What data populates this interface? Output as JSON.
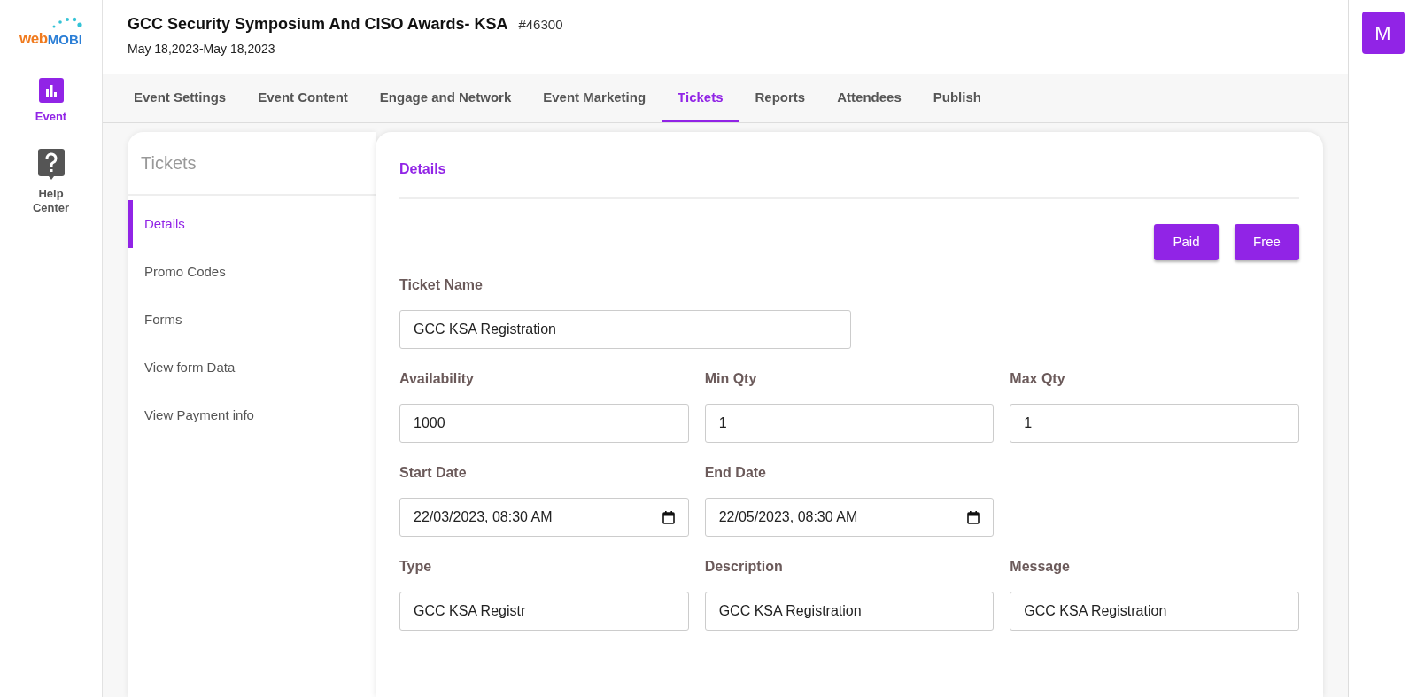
{
  "logo": {
    "first": "web",
    "second": "MOBI"
  },
  "sidebar": {
    "items": [
      {
        "label": "Event",
        "kind": "chart",
        "selected": true
      },
      {
        "label": "Help Center",
        "kind": "help",
        "selected": false
      }
    ]
  },
  "header": {
    "title": "GCC Security Symposium And CISO Awards- KSA",
    "event_id": "#46300",
    "dates": "May 18,2023-May 18,2023"
  },
  "avatar": "M",
  "tabs": [
    {
      "label": "Event Settings",
      "selected": false
    },
    {
      "label": "Event Content",
      "selected": false
    },
    {
      "label": "Engage and Network",
      "selected": false
    },
    {
      "label": "Event Marketing",
      "selected": false
    },
    {
      "label": "Tickets",
      "selected": true
    },
    {
      "label": "Reports",
      "selected": false
    },
    {
      "label": "Attendees",
      "selected": false
    },
    {
      "label": "Publish",
      "selected": false
    }
  ],
  "submenu": {
    "title": "Tickets",
    "items": [
      {
        "label": "Details",
        "selected": true
      },
      {
        "label": "Promo Codes",
        "selected": false
      },
      {
        "label": "Forms",
        "selected": false
      },
      {
        "label": "View form Data",
        "selected": false
      },
      {
        "label": "View Payment info",
        "selected": false
      }
    ]
  },
  "details": {
    "title": "Details",
    "buttons": [
      "Paid",
      "Free"
    ],
    "rows": [
      [
        {
          "label": "Ticket Name",
          "value": "GCC KSA Registration",
          "kind": "text"
        }
      ],
      [
        {
          "label": "Availability",
          "value": "1000",
          "kind": "text"
        },
        {
          "label": "Min Qty",
          "value": "1",
          "kind": "text"
        },
        {
          "label": "Max Qty",
          "value": "1",
          "kind": "text"
        }
      ],
      [
        {
          "label": "Start Date",
          "value": "22/03/2023, 08:30 AM",
          "kind": "date"
        },
        {
          "label": "End Date",
          "value": "22/05/2023, 08:30 AM",
          "kind": "date"
        }
      ],
      [
        {
          "label": "Type",
          "value": "GCC KSA Registr",
          "kind": "text"
        },
        {
          "label": "Description",
          "value": "GCC KSA Registration",
          "kind": "text"
        },
        {
          "label": "Message",
          "value": "GCC KSA Registration",
          "kind": "text"
        }
      ]
    ]
  }
}
